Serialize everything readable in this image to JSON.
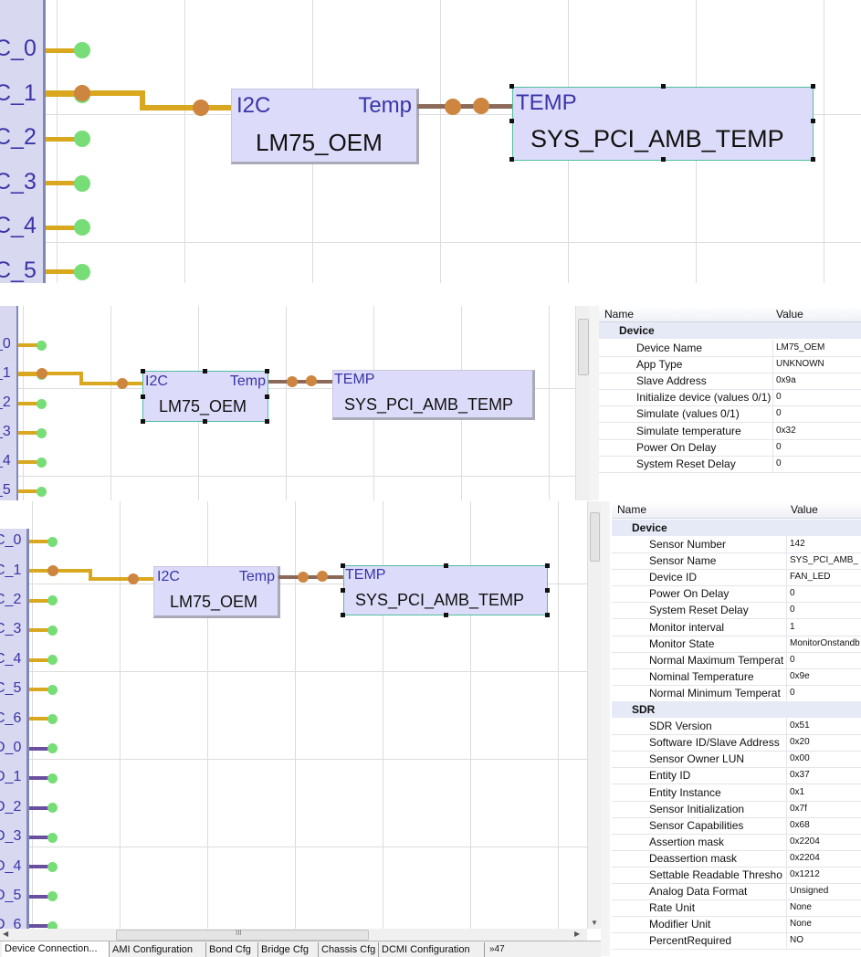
{
  "colors": {
    "bus_wire": "#d9a81e",
    "link_wire": "#8b6a5a",
    "pin_dot": "#77dd77",
    "node_dot": "#cd853f",
    "block_fill": "#dcdcfa",
    "pin_text": "#3a34a8"
  },
  "diagram": {
    "source_port": "I2C",
    "source_out_port": "Temp",
    "source_name": "LM75_OEM",
    "sensor_port": "TEMP",
    "sensor_name": "SYS_PCI_AMB_TEMP"
  },
  "panel1": {
    "pins": [
      "C_0",
      "C_1",
      "C_2",
      "C_3",
      "C_4",
      "C_5"
    ]
  },
  "panel2": {
    "pins": [
      "_0",
      "_1",
      "_2",
      "_3",
      "_4",
      "_5"
    ],
    "props": {
      "header_name": "Name",
      "header_value": "Value",
      "category": "Device",
      "rows": [
        {
          "name": "Device Name",
          "value": "LM75_OEM"
        },
        {
          "name": "App Type",
          "value": "UNKNOWN"
        },
        {
          "name": "Slave Address",
          "value": "0x9a"
        },
        {
          "name": "Initialize device (values 0/1)",
          "value": "0"
        },
        {
          "name": "Simulate (values 0/1)",
          "value": "0"
        },
        {
          "name": "Simulate temperature",
          "value": "0x32"
        },
        {
          "name": "Power On Delay",
          "value": "0"
        },
        {
          "name": "System Reset Delay",
          "value": "0"
        }
      ]
    }
  },
  "panel3": {
    "pins": [
      "C_0",
      "C_1",
      "C_2",
      "C_3",
      "C_4",
      "C_5",
      "C_6",
      "D_0",
      "D_1",
      "D_2",
      "D_3",
      "D_4",
      "D_5",
      "D_6"
    ],
    "props": {
      "header_name": "Name",
      "header_value": "Value",
      "category_device": "Device",
      "device_rows": [
        {
          "name": "Sensor Number",
          "value": "142"
        },
        {
          "name": "Sensor Name",
          "value": "SYS_PCI_AMB_"
        },
        {
          "name": "Device ID",
          "value": "FAN_LED"
        },
        {
          "name": "Power On Delay",
          "value": "0"
        },
        {
          "name": "System Reset Delay",
          "value": "0"
        },
        {
          "name": "Monitor interval",
          "value": "1"
        },
        {
          "name": "Monitor State",
          "value": "MonitorOnstandb"
        },
        {
          "name": "Normal Maximum Temperat",
          "value": "0"
        },
        {
          "name": "Nominal Temperature",
          "value": "0x9e"
        },
        {
          "name": "Normal Minimum Temperat",
          "value": "0"
        }
      ],
      "category_sdr": "SDR",
      "sdr_rows": [
        {
          "name": "SDR Version",
          "value": "0x51"
        },
        {
          "name": "Software ID/Slave Address",
          "value": "0x20"
        },
        {
          "name": "Sensor Owner LUN",
          "value": "0x00"
        },
        {
          "name": "Entity ID",
          "value": "0x37"
        },
        {
          "name": "Entity Instance",
          "value": "0x1"
        },
        {
          "name": "Sensor Initialization",
          "value": "0x7f"
        },
        {
          "name": "Sensor Capabilities",
          "value": "0x68"
        },
        {
          "name": "Assertion mask",
          "value": "0x2204"
        },
        {
          "name": "Deassertion mask",
          "value": "0x2204"
        },
        {
          "name": "Settable Readable Thresho",
          "value": "0x1212"
        },
        {
          "name": "Analog Data Format",
          "value": "Unsigned"
        },
        {
          "name": "Rate Unit",
          "value": "None"
        },
        {
          "name": "Modifier Unit",
          "value": "None"
        },
        {
          "name": "PercentRequired",
          "value": "NO"
        }
      ]
    },
    "tabs": [
      "Device Connection...",
      "AMI Configuration",
      "Bond Cfg",
      "Bridge Cfg",
      "Chassis Cfg",
      "DCMI Configuration"
    ],
    "tab_more": "»47",
    "scroll_grip": "III"
  }
}
